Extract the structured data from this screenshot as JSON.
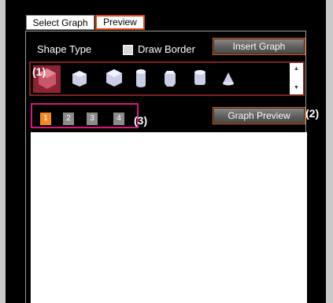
{
  "tabs": {
    "select_graph": "Select Graph",
    "preview": "Preview"
  },
  "shape_type_label": "Shape Type",
  "draw_border_label": "Draw Border",
  "draw_border_checked": false,
  "buttons": {
    "insert_graph": "Insert Graph",
    "graph_preview": "Graph Preview"
  },
  "shapes": {
    "items": [
      "hexagonal-prism-icon",
      "pentagonal-prism-icon",
      "hexagon-cube-icon",
      "cylinder-icon",
      "octagonal-prism-icon",
      "rounded-cylinder-icon",
      "cone-icon"
    ],
    "selected_index": 0
  },
  "scrollbar": {
    "up_icon": "▲",
    "down_icon": "▼"
  },
  "pager": {
    "pages": [
      "1",
      "2",
      "3",
      "4"
    ],
    "active_page": "1"
  },
  "annotations": {
    "a1": "(1)",
    "a2": "(2)",
    "a3": "(3)"
  },
  "colors": {
    "tab_highlight": "#e04a17",
    "selected_shape_bg": "#8d2333",
    "active_page": "#f08a24",
    "pager_highlight": "#d4177a"
  }
}
